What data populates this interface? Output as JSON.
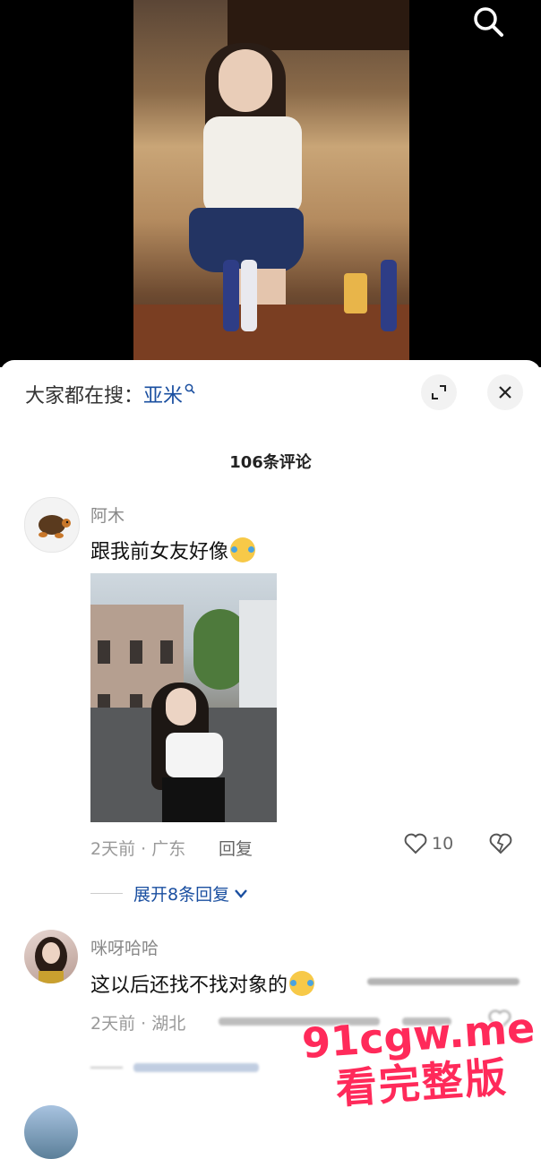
{
  "sheet": {
    "hot_search_label": "大家都在搜：",
    "hot_search_keyword": "亚米",
    "comment_count": "106条评论"
  },
  "comments": [
    {
      "author": "阿木",
      "text": "跟我前女友好像",
      "emoji": "rofl-emoji",
      "meta": "2天前 · 广东",
      "reply": "回复",
      "likes": "10",
      "expand_replies": "展开8条回复"
    },
    {
      "author": "咪呀哈哈",
      "text": "这以后还找不找对象的",
      "emoji": "rofl-emoji",
      "meta": "2天前 · 湖北"
    }
  ],
  "watermark": {
    "domain": "91cgw.me",
    "slogan": "看完整版"
  },
  "colors": {
    "link": "#1a4fa0",
    "watermark": "#ff2a5a"
  }
}
